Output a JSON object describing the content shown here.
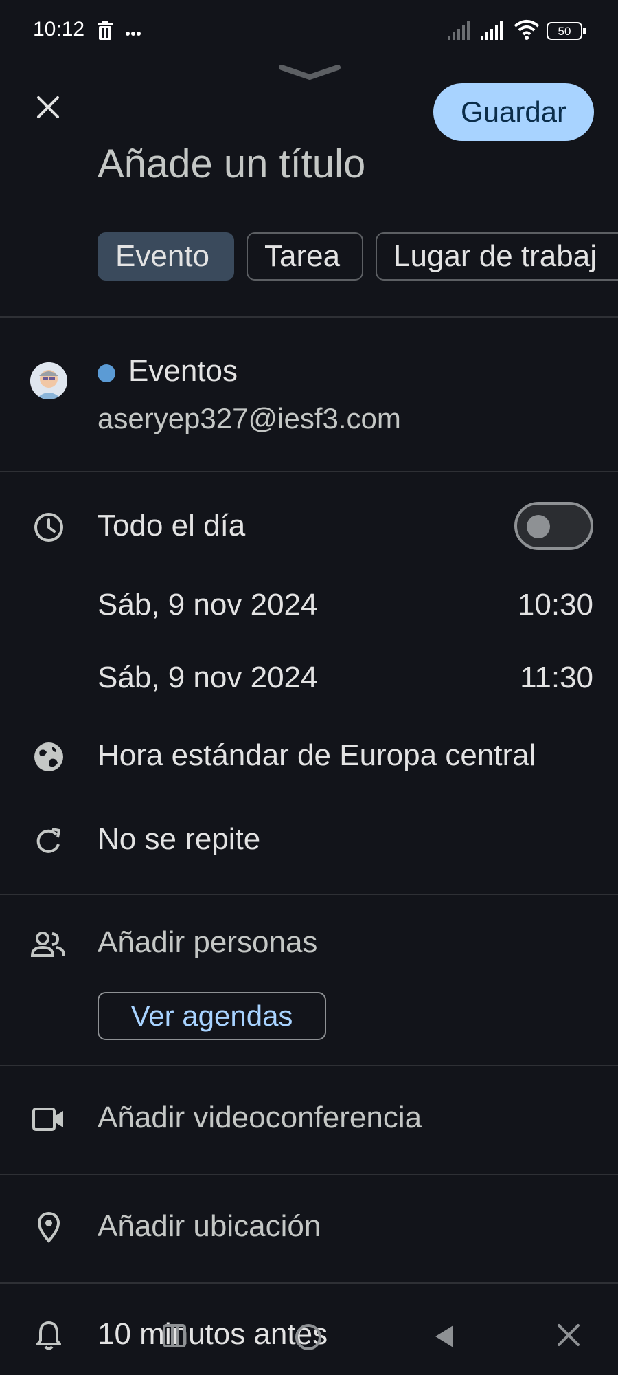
{
  "status_bar": {
    "time": "10:12",
    "icons": [
      "trash-icon",
      "more-dots-icon",
      "signal-icon",
      "signal-icon",
      "wifi-icon",
      "battery-icon"
    ],
    "battery": "50"
  },
  "header": {
    "collapse_icon": "chevron-down-icon",
    "close_icon": "close-icon",
    "save_label": "Guardar",
    "title_placeholder": "Añade un título"
  },
  "type_chips": [
    {
      "label": "Evento",
      "selected": true
    },
    {
      "label": "Tarea",
      "selected": false
    },
    {
      "label": "Lugar de trabaj",
      "selected": false
    }
  ],
  "calendar": {
    "name": "Eventos",
    "account": "aseryep327@iesf3.com",
    "dot_color": "#5b9bd5"
  },
  "time_section": {
    "all_day_label": "Todo el día",
    "all_day_on": false,
    "start_date": "Sáb, 9 nov 2024",
    "start_time": "10:30",
    "end_date": "Sáb, 9 nov 2024",
    "end_time": "11:30",
    "timezone": "Hora estándar de Europa central",
    "repeat": "No se repite"
  },
  "people": {
    "add_label": "Añadir personas",
    "view_schedules": "Ver agendas"
  },
  "video": {
    "label": "Añadir videoconferencia"
  },
  "location": {
    "label": "Añadir ubicación"
  },
  "notification": {
    "label": "10 minutos antes"
  },
  "colors": {
    "background": "#12141a",
    "accent": "#a8d3ff",
    "divider": "#2e3035"
  }
}
